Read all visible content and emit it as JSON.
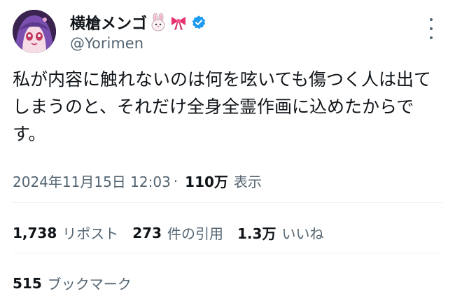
{
  "author": {
    "display_name": "横槍メンゴ",
    "handle": "@Yorimen",
    "name_emojis": [
      "rabbit-face-emoji",
      "ribbon-emoji"
    ],
    "verified_color": "#1d9bf0"
  },
  "tweet": {
    "text": "私が内容に触れないのは何を呟いても傷つく人は出てしまうのと、それだけ全身全霊作画に込めたからです。"
  },
  "meta": {
    "timestamp": "2024年11月15日 12:03",
    "separator": "·",
    "views_count": "110万",
    "views_label": "表示"
  },
  "stats": {
    "reposts_count": "1,738",
    "reposts_label": "リポスト",
    "quotes_count": "273",
    "quotes_label": "件の引用",
    "likes_count": "1.3万",
    "likes_label": "いいね",
    "bookmarks_count": "515",
    "bookmarks_label": "ブックマーク"
  }
}
